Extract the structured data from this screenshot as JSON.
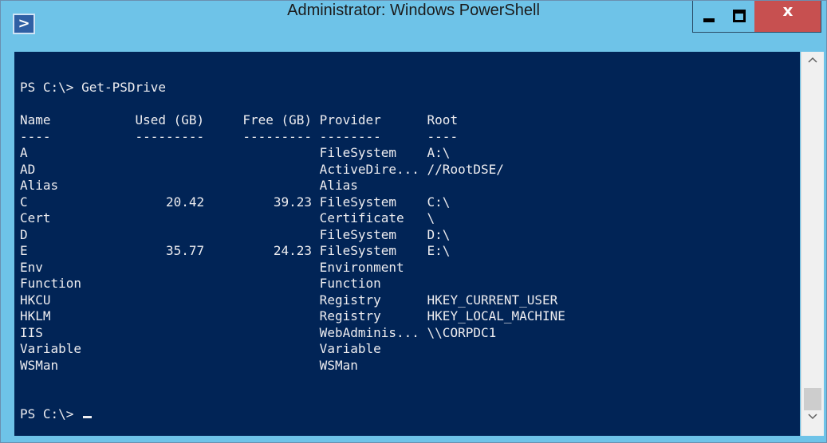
{
  "window": {
    "title": "Administrator: Windows PowerShell",
    "controls": {
      "minimize": "minimize-icon",
      "maximize": "maximize-icon",
      "close_glyph": "x"
    }
  },
  "console": {
    "lines": [
      "PS C:\\> Get-PSDrive",
      "",
      "Name           Used (GB)     Free (GB) Provider      Root",
      "----           ---------     --------- --------      ----",
      "A                                      FileSystem    A:\\",
      "AD                                     ActiveDire... //RootDSE/",
      "Alias                                  Alias",
      "C                  20.42         39.23 FileSystem    C:\\",
      "Cert                                   Certificate   \\",
      "D                                      FileSystem    D:\\",
      "E                  35.77         24.23 FileSystem    E:\\",
      "Env                                    Environment",
      "Function                               Function",
      "HKCU                                   Registry      HKEY_CURRENT_USER",
      "HKLM                                   Registry      HKEY_LOCAL_MACHINE",
      "IIS                                    WebAdminis... \\\\CORPDC1",
      "Variable                               Variable",
      "WSMan                                  WSMan",
      "",
      "",
      "PS C:\\> "
    ]
  },
  "colors": {
    "console_background": "#012456",
    "console_text": "#eeedf0",
    "titlebar": "#6ec3e8",
    "close_button": "#c75050"
  },
  "scrollbar": {
    "up_icon": "chevron-up-icon",
    "down_icon": "chevron-down-icon"
  }
}
